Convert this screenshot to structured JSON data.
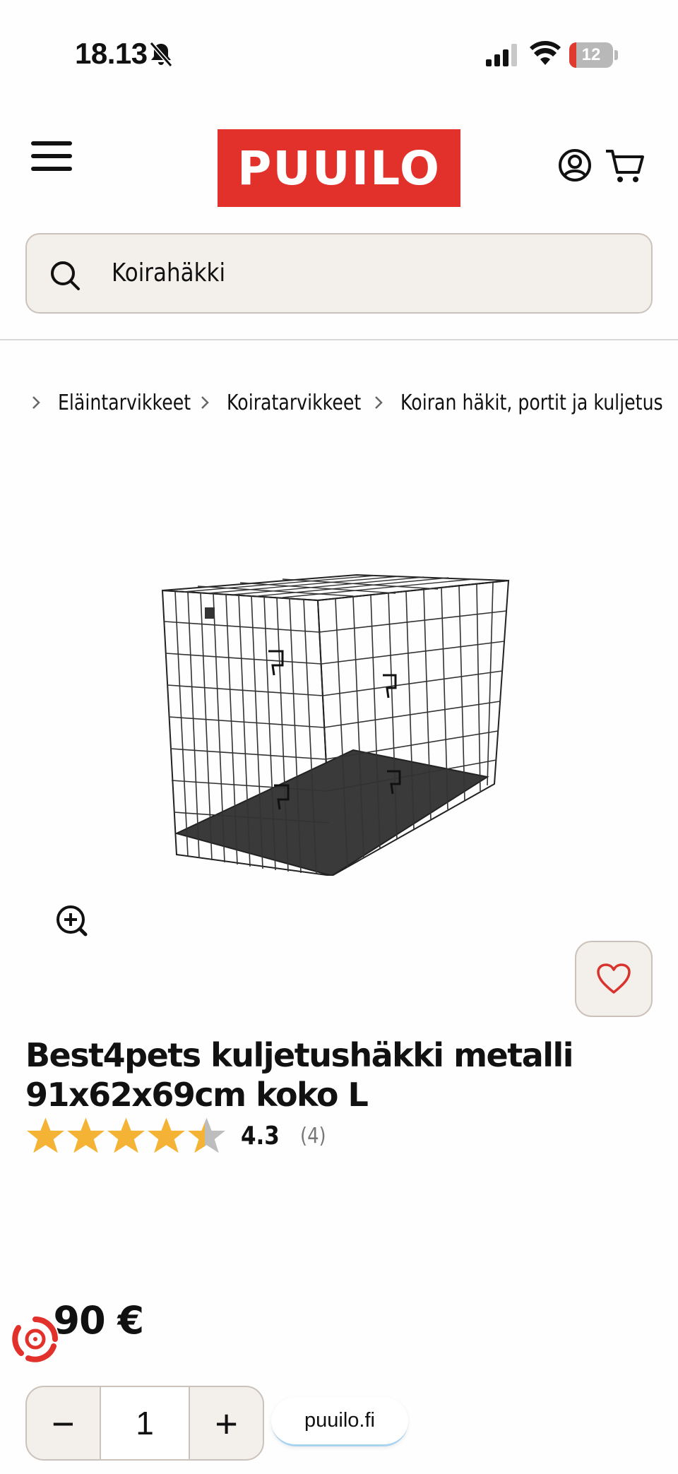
{
  "status_bar": {
    "time": "18.13",
    "battery_level": "12",
    "icons": [
      "bell-slash-icon",
      "cellular-signal-icon",
      "wifi-icon",
      "battery-icon"
    ]
  },
  "header": {
    "logo_text": "PUUILO",
    "brand_color": "#e2302b",
    "icons": [
      "menu-icon",
      "account-icon",
      "cart-icon"
    ]
  },
  "search": {
    "value": "Koirahäkki"
  },
  "breadcrumb": [
    {
      "label": "Eläintarvikkeet"
    },
    {
      "label": "Koiratarvikkeet"
    },
    {
      "label": "Koiran häkit, portit ja kuljetus"
    }
  ],
  "product": {
    "title": "Best4pets kuljetushäkki metalli 91x62x69cm koko L",
    "rating": 4.3,
    "rating_text": "4.3",
    "rating_count": "(4)",
    "price_visible": ",90 €",
    "star_color": "#f5b335"
  },
  "quantity": {
    "value": "1",
    "decrease_label": "−",
    "increase_label": "+"
  },
  "browser": {
    "url": "puuilo.fi"
  }
}
